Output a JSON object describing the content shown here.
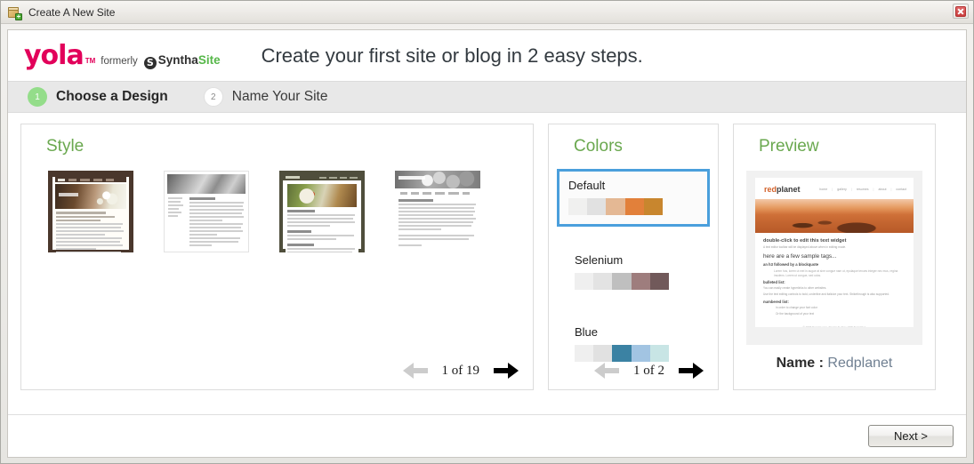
{
  "window": {
    "title": "Create A New Site",
    "icon": "new-site-package-icon",
    "close_label": "✕"
  },
  "header": {
    "logo": {
      "yola": "yola",
      "tm": "TM",
      "formerly": "formerly",
      "mark": "S",
      "syntha": "Syntha",
      "site": "Site"
    },
    "title": "Create your first site or blog in 2 easy steps."
  },
  "steps": [
    {
      "number": "1",
      "label": "Choose a Design",
      "state": "active"
    },
    {
      "number": "2",
      "label": "Name Your Site",
      "state": "inactive"
    }
  ],
  "style_panel": {
    "title": "Style",
    "thumbnails": [
      {
        "name": "theme-thumbnail-1",
        "selected": true
      },
      {
        "name": "theme-thumbnail-2",
        "selected": false
      },
      {
        "name": "theme-thumbnail-3",
        "selected": false
      },
      {
        "name": "theme-thumbnail-4",
        "selected": false
      }
    ],
    "pager": {
      "prev_icon": "arrow-left-icon",
      "next_icon": "arrow-right-icon",
      "text": "1 of 19",
      "current": 1,
      "total": 19,
      "prev_enabled": false,
      "next_enabled": true
    }
  },
  "colors_panel": {
    "title": "Colors",
    "selection_border": "#4a9fdc",
    "swatches": [
      {
        "name": "Default",
        "selected": true,
        "colors": [
          "#f0f0ef",
          "#e1e1e1",
          "#e4b894",
          "#e2803a",
          "#c8862e"
        ]
      },
      {
        "name": "Selenium",
        "selected": false,
        "colors": [
          "#efefef",
          "#e3e3e3",
          "#bfbfbf",
          "#9e7d7d",
          "#71595a"
        ]
      },
      {
        "name": "Blue",
        "selected": false,
        "colors": [
          "#efefef",
          "#e1e1e1",
          "#3b82a3",
          "#a2c4e2",
          "#c8e5e5"
        ]
      }
    ],
    "pager": {
      "prev_icon": "arrow-left-icon",
      "next_icon": "arrow-right-icon",
      "text": "1 of 2",
      "current": 1,
      "total": 2,
      "prev_enabled": false,
      "next_enabled": true
    }
  },
  "preview_panel": {
    "title": "Preview",
    "site": {
      "brand_first": "red",
      "brand_second": "planet",
      "nav": [
        "home",
        "gallery",
        "resumes",
        "about",
        "contact"
      ],
      "heading_widget": "double-click to edit this text widget",
      "subtext": "A text editor toolbar will be displayed above when in editing mode.",
      "tags_heading": "here are a few sample tags...",
      "h3_line": "an h3 followed by a blockquote",
      "blockquote": "Lorem hos, lorem ut mel in augue at sine congue nam ut, epulaque tenues integer nec mus, regina insolens. Lorem ut congue, sed udos.",
      "bulleted_label": "bulleted list:",
      "bullet_1": "You can easily create hyperlinks to other websites.",
      "bullet_2": "Use the text editing controls to bold, underline and italicize your text. Strikethrough is also supported.",
      "numbered_label": "numbered list:",
      "numbered_1": "In order to change your font color",
      "numbered_2": "Or the background of your text",
      "footer": "© 2007 Domain.com. Design by Free CSS Templates"
    },
    "name_label": "Name :",
    "name_value": "Redplanet"
  },
  "footer": {
    "next_label": "Next >"
  }
}
